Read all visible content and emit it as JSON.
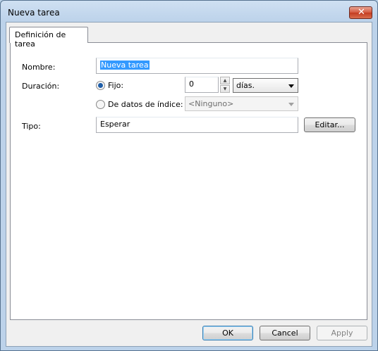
{
  "window": {
    "title": "Nueva tarea",
    "close_symbol": "✕"
  },
  "tabs": [
    {
      "label": "Definición de tarea",
      "selected": true
    }
  ],
  "form": {
    "name_label": "Nombre:",
    "name_value": "Nueva tarea",
    "duration_label": "Duración:",
    "fixed_label": "Fijo:",
    "fixed_selected": true,
    "fixed_value": "0",
    "unit_value": "días.",
    "index_label": "De datos de índice:",
    "index_selected": false,
    "index_value": "<Ninguno>",
    "type_label": "Tipo:",
    "type_value": "Esperar",
    "edit_label": "Editar..."
  },
  "buttons": {
    "ok": "OK",
    "cancel": "Cancel",
    "apply": "Apply"
  },
  "colors": {
    "selection": "#3399ff",
    "radio_dot": "#1f5ea8",
    "close_button": "#c33c20"
  }
}
